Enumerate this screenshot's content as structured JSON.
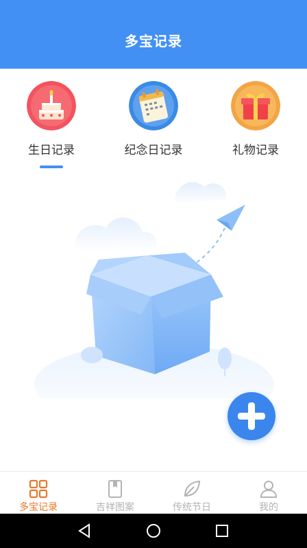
{
  "header": {
    "title": "多宝记录"
  },
  "tabs": [
    {
      "label": "生日记录",
      "icon": "birthday-cake-icon",
      "active": true
    },
    {
      "label": "纪念日记录",
      "icon": "calendar-icon",
      "active": false
    },
    {
      "label": "礼物记录",
      "icon": "gift-icon",
      "active": false
    }
  ],
  "fab": {
    "icon": "plus-icon"
  },
  "bottom_nav": [
    {
      "label": "多宝记录",
      "icon": "grid-icon",
      "active": true
    },
    {
      "label": "吉祥图案",
      "icon": "bookmark-icon",
      "active": false
    },
    {
      "label": "传统节日",
      "icon": "leaf-icon",
      "active": false
    },
    {
      "label": "我的",
      "icon": "user-icon",
      "active": false
    }
  ],
  "system_nav": [
    "back-icon",
    "home-icon",
    "recents-icon"
  ],
  "colors": {
    "primary": "#4390f4",
    "active_nav": "#e8772a",
    "inactive_nav": "#b3b3b3",
    "birthday_bg": "#f2535f",
    "calendar_bg": "#3a8ae6",
    "gift_bg": "#f3a444"
  }
}
